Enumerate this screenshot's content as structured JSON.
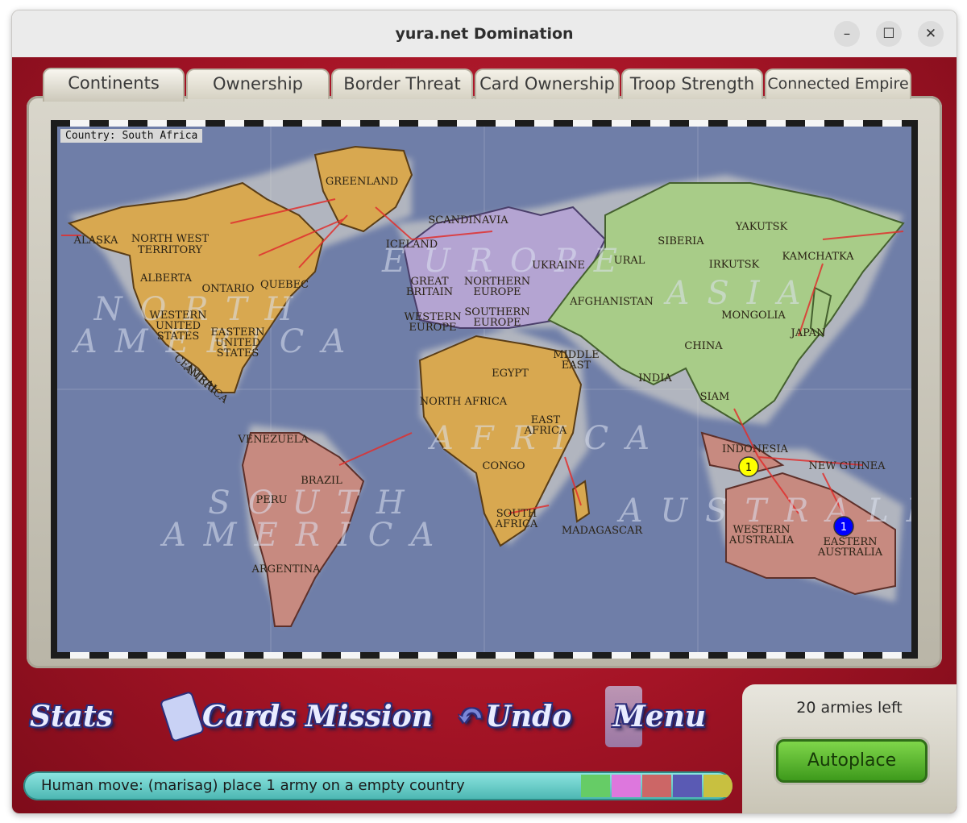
{
  "window": {
    "title": "yura.net Domination",
    "controls": {
      "minimize": "–",
      "maximize": "☐",
      "close": "✕"
    }
  },
  "tabs": [
    {
      "label": "Continents",
      "active": true
    },
    {
      "label": "Ownership",
      "active": false
    },
    {
      "label": "Border Threat",
      "active": false
    },
    {
      "label": "Card Ownership",
      "active": false
    },
    {
      "label": "Troop Strength",
      "active": false
    },
    {
      "label": "Connected Empire",
      "active": false
    }
  ],
  "map": {
    "country_readout": "Country: South Africa",
    "continents": [
      "NORTH AMERICA",
      "EUROPE",
      "ASIA",
      "AFRICA",
      "SOUTH AMERICA",
      "AUSTRALIA"
    ],
    "continent_labels": {
      "north_america_1": "NORTH",
      "north_america_2": "AMERICA",
      "europe": "EUROPE",
      "asia": "ASIA",
      "africa": "AFRICA",
      "south_america_1": "SOUTH",
      "south_america_2": "AMERICA",
      "australia": "AUSTRALIA"
    },
    "territories": {
      "alaska": "ALASKA",
      "northwest_territory_1": "NORTH WEST",
      "northwest_territory_2": "TERRITORY",
      "greenland": "GREENLAND",
      "alberta": "ALBERTA",
      "ontario": "ONTARIO",
      "quebec": "QUEBEC",
      "western_us_1": "WESTERN",
      "western_us_2": "UNITED",
      "western_us_3": "STATES",
      "eastern_us_1": "EASTERN",
      "eastern_us_2": "UNITED",
      "eastern_us_3": "STATES",
      "central_america_1": "CENTRAL",
      "central_america_2": "AMERICA",
      "iceland": "ICELAND",
      "scandinavia": "SCANDINAVIA",
      "great_britain_1": "GREAT",
      "great_britain_2": "BRITAIN",
      "northern_europe_1": "NORTHERN",
      "northern_europe_2": "EUROPE",
      "western_europe_1": "WESTERN",
      "western_europe_2": "EUROPE",
      "southern_europe_1": "SOUTHERN",
      "southern_europe_2": "EUROPE",
      "ukraine": "UKRAINE",
      "ural": "URAL",
      "siberia": "SIBERIA",
      "yakutsk": "YAKUTSK",
      "kamchatka": "KAMCHATKA",
      "irkutsk": "IRKUTSK",
      "mongolia": "MONGOLIA",
      "japan": "JAPAN",
      "afghanistan": "AFGHANISTAN",
      "china": "CHINA",
      "middle_east_1": "MIDDLE",
      "middle_east_2": "EAST",
      "india": "INDIA",
      "siam": "SIAM",
      "egypt": "EGYPT",
      "north_africa": "NORTH AFRICA",
      "east_africa_1": "EAST",
      "east_africa_2": "AFRICA",
      "congo": "CONGO",
      "south_africa_1": "SOUTH",
      "south_africa_2": "AFRICA",
      "madagascar": "MADAGASCAR",
      "venezuela": "VENEZUELA",
      "brazil": "BRAZIL",
      "peru": "PERU",
      "argentina": "ARGENTINA",
      "indonesia": "INDONESIA",
      "new_guinea": "NEW GUINEA",
      "western_australia_1": "WESTERN",
      "western_australia_2": "AUSTRALIA",
      "eastern_australia_1": "EASTERN",
      "eastern_australia_2": "AUSTRALIA"
    },
    "armies": [
      {
        "territory": "Indonesia",
        "count": "1",
        "color": "#ffff00"
      },
      {
        "territory": "Eastern Australia",
        "count": "1",
        "color": "#0000ff"
      }
    ]
  },
  "bottom": {
    "buttons": {
      "stats": "Stats",
      "cards": "Cards",
      "mission": "Mission",
      "undo": "Undo",
      "menu": "Menu"
    },
    "status_text": "Human move: (marisag) place 1 army on a empty country",
    "player_colors": [
      "#66cc66",
      "#dd77dd",
      "#cc6666",
      "#5a5ab4",
      "#c8c040"
    ],
    "armies_left": "20 armies left",
    "autoplace_label": "Autoplace"
  }
}
